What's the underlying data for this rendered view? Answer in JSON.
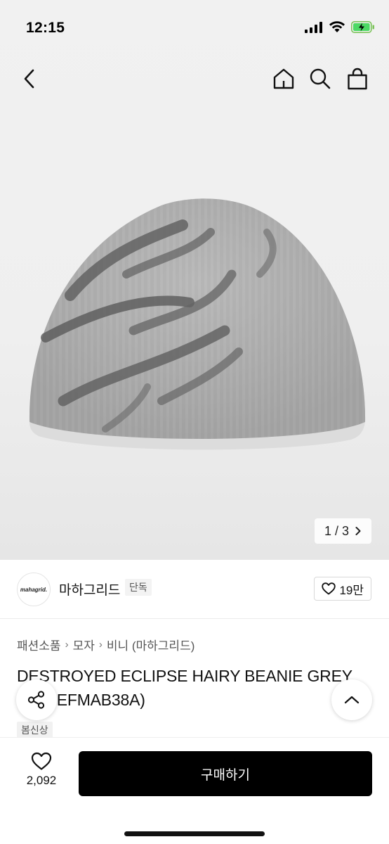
{
  "status_bar": {
    "time": "12:15"
  },
  "nav": {
    "icons": [
      "back-chevron-icon",
      "home-icon",
      "search-icon",
      "shopping-bag-icon"
    ]
  },
  "gallery": {
    "pager": "1 / 3",
    "image_alt": "grey hairy beanie product photo"
  },
  "brand": {
    "logo_text": "mahagrid.",
    "name": "마하그리드",
    "tag": "단독",
    "likes": "19만"
  },
  "breadcrumb": {
    "items": [
      "패션소품",
      "모자",
      "비니 (마하그리드)"
    ]
  },
  "product": {
    "title": "DESTROYED ECLIPSE HAIRY BEANIE GREY (MG2EFMAB38A)",
    "badge": "봄신상"
  },
  "bottom": {
    "wish_count": "2,092",
    "buy_label": "구매하기"
  },
  "colors": {
    "buy_button": "#000000",
    "background": "#ffffff",
    "hero_bg": "#efefef"
  }
}
